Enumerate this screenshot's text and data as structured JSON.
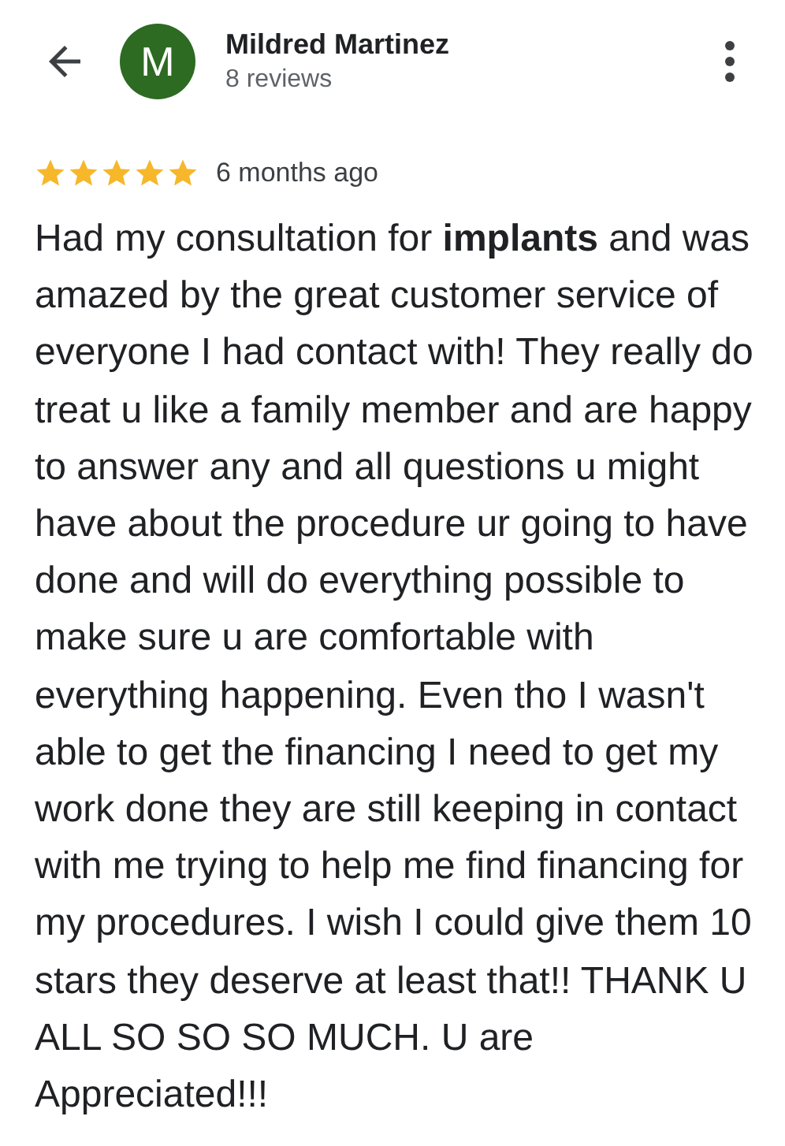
{
  "header": {
    "avatar_letter": "M",
    "color": "#2d6a22",
    "name": "Mildred Martinez",
    "subtitle": "8 reviews"
  },
  "review": {
    "stars": 5,
    "time": "6 months ago",
    "text": "Had my consultation for **implants** and was amazed by the great customer service of everyone I had contact with! They really do treat u like a family member and are happy to answer any and all questions u might have about the procedure ur going to have done and will do everything possible to make sure u are comfortable with everything happening. Even tho I wasn't able to get the financing I need to get my work done they are still keeping in contact with me trying to help me find financing for my procedures. I wish I could give them 10 stars they deserve at least that!! THANK U ALL SO SO SO MUCH. U are Appreciated!!!"
  }
}
